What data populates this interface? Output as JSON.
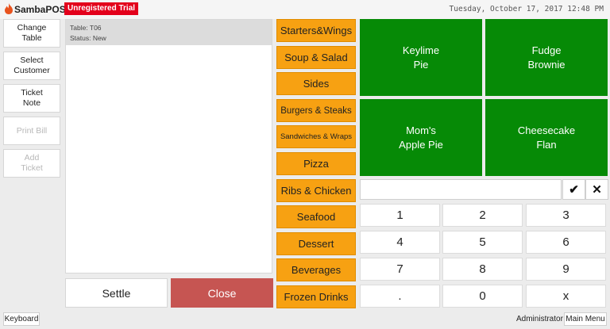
{
  "header": {
    "app_title": "SambaPOS 6",
    "trial_badge": "Unregistered Trial",
    "datetime": "Tuesday, October 17, 2017 12:48 PM",
    "logo_icon": "flame-icon",
    "logo_color": "#e8531e"
  },
  "left_actions": [
    {
      "label": "Change\nTable",
      "enabled": true
    },
    {
      "label": "Select\nCustomer",
      "enabled": true
    },
    {
      "label": "Ticket\nNote",
      "enabled": true
    },
    {
      "label": "Print Bill",
      "enabled": false
    },
    {
      "label": "Add\nTicket",
      "enabled": false
    }
  ],
  "ticket": {
    "table_line": "Table: T06",
    "status_line": "Status: New"
  },
  "bottom_buttons": {
    "settle": "Settle",
    "close": "Close"
  },
  "categories": [
    "Starters&Wings",
    "Soup & Salad",
    "Sides",
    "Burgers & Steaks",
    "Sandwiches & Wraps",
    "Pizza",
    "Ribs & Chicken",
    "Seafood",
    "Dessert",
    "Beverages",
    "Frozen Drinks"
  ],
  "menu_items": [
    "Keylime\nPie",
    "Fudge\nBrownie",
    "Mom's\nApple Pie",
    "Cheesecake\nFlan"
  ],
  "numpad": {
    "input_value": "",
    "ok_icon": "checkmark-icon",
    "ok_glyph": "✔",
    "clear_icon": "close-icon",
    "clear_glyph": "✕",
    "keys": [
      "1",
      "2",
      "3",
      "4",
      "5",
      "6",
      "7",
      "8",
      "9",
      ".",
      "0",
      "x"
    ]
  },
  "footer": {
    "keyboard": "Keyboard",
    "user": "Administrator",
    "main_menu": "Main Menu"
  },
  "colors": {
    "category": "#f7a112",
    "menu_item": "#068a06",
    "close_button": "#c65552",
    "trial_badge": "#e3001b"
  }
}
